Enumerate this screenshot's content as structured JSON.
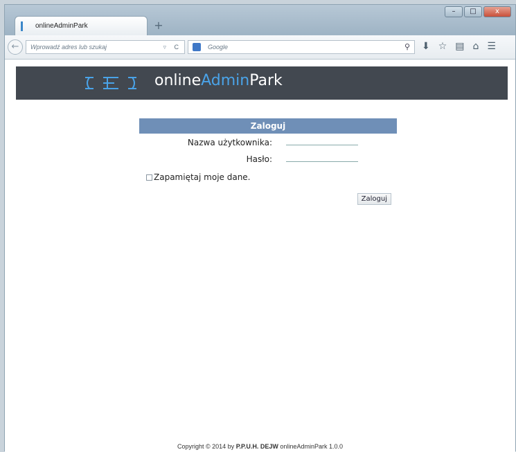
{
  "browser": {
    "tab_title": "onlineAdminPark",
    "new_tab": "+",
    "url_placeholder": "Wprowadź adres lub szukaj",
    "search_placeholder": "Google",
    "window_buttons": [
      "–",
      "□",
      "x"
    ],
    "icons": [
      "magnifier-icon",
      "download-icon",
      "star-icon",
      "clipboard-icon",
      "home-icon",
      "menu-icon"
    ]
  },
  "site": {
    "brand_prefix": "online",
    "brand_accent": "Admin",
    "brand_suffix": "Park",
    "accent_color": "#4aa3e8"
  },
  "login": {
    "title": "Zaloguj",
    "username_label": "Nazwa użytkownika:",
    "username_value": "",
    "password_label": "Hasło:",
    "password_value": "",
    "remember_label": "Zapamiętaj moje dane.",
    "submit_label": "Zaloguj"
  },
  "footer": {
    "text": "Copyright © 2014 by",
    "company": "P.P.U.H. DEJW",
    "version": "onlineAdminPark 1.0.0"
  }
}
